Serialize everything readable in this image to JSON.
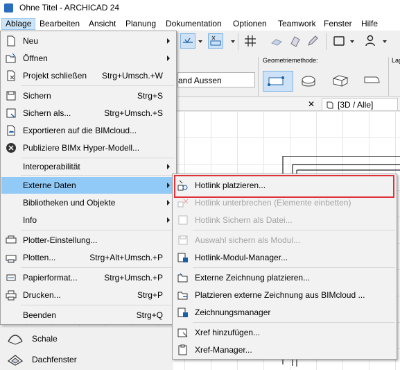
{
  "window": {
    "title": "Ohne Titel - ARCHICAD 24"
  },
  "menubar": {
    "items": [
      "Ablage",
      "Bearbeiten",
      "Ansicht",
      "Planung",
      "Dokumentation",
      "Optionen",
      "Teamwork",
      "Fenster",
      "Hilfe"
    ],
    "active": "Ablage"
  },
  "toolbar": {
    "geometry_label": "Geometriemethode:",
    "layer_combo_text": "and Aussen",
    "right_edge_label": "Lag"
  },
  "tabs": {
    "view_tab": "[3D / Alle]"
  },
  "toolbox": {
    "items": [
      "Schale",
      "Dachfenster"
    ]
  },
  "ablage_menu": {
    "items": [
      {
        "label": "Neu",
        "shortcut": "",
        "submenu": true,
        "icon": "new-document-icon"
      },
      {
        "label": "Öffnen",
        "shortcut": "",
        "submenu": true,
        "icon": "open-folder-icon"
      },
      {
        "label": "Projekt schließen",
        "shortcut": "Strg+Umsch.+W",
        "submenu": false,
        "icon": "close-project-icon"
      },
      {
        "label": "Sichern",
        "shortcut": "Strg+S",
        "submenu": false,
        "icon": "save-icon"
      },
      {
        "label": "Sichern als...",
        "shortcut": "Strg+Umsch.+S",
        "submenu": false,
        "icon": "save-as-icon"
      },
      {
        "label": "Exportieren auf die BIMcloud...",
        "shortcut": "",
        "submenu": false,
        "icon": "bimcloud-export-icon"
      },
      {
        "label": "Publiziere BIMx Hyper-Modell...",
        "shortcut": "",
        "submenu": false,
        "icon": "bimx-icon"
      },
      {
        "label": "Interoperabilität",
        "shortcut": "",
        "submenu": true,
        "icon": ""
      },
      {
        "label": "Externe Daten",
        "shortcut": "",
        "submenu": true,
        "icon": ""
      },
      {
        "label": "Bibliotheken und Objekte",
        "shortcut": "",
        "submenu": true,
        "icon": ""
      },
      {
        "label": "Info",
        "shortcut": "",
        "submenu": true,
        "icon": ""
      },
      {
        "label": "Plotter-Einstellung...",
        "shortcut": "",
        "submenu": false,
        "icon": "plotter-setup-icon"
      },
      {
        "label": "Plotten...",
        "shortcut": "Strg+Alt+Umsch.+P",
        "submenu": false,
        "icon": "plot-icon"
      },
      {
        "label": "Papierformat...",
        "shortcut": "Strg+Umsch.+P",
        "submenu": false,
        "icon": "page-setup-icon"
      },
      {
        "label": "Drucken...",
        "shortcut": "Strg+P",
        "submenu": false,
        "icon": "print-icon"
      },
      {
        "label": "Beenden",
        "shortcut": "Strg+Q",
        "submenu": false,
        "icon": ""
      }
    ]
  },
  "extern_submenu": {
    "items": [
      {
        "label": "Hotlink platzieren...",
        "disabled": false,
        "icon": "hotlink-place-icon"
      },
      {
        "label": "Hotlink unterbrechen (Elemente einbetten)",
        "disabled": true,
        "icon": "hotlink-break-icon"
      },
      {
        "label": "Hotlink Sichern als Datei...",
        "disabled": true,
        "icon": "hotlink-save-icon"
      },
      {
        "label": "Auswahl sichern als Modul...",
        "disabled": true,
        "icon": "save-module-icon"
      },
      {
        "label": "Hotlink-Modul-Manager...",
        "disabled": false,
        "icon": "hotlink-manager-icon"
      },
      {
        "label": "Externe Zeichnung platzieren...",
        "disabled": false,
        "icon": "external-drawing-icon"
      },
      {
        "label": "Platzieren externe Zeichnung aus BIMcloud ...",
        "disabled": false,
        "icon": "bimcloud-drawing-icon"
      },
      {
        "label": "Zeichnungsmanager",
        "disabled": false,
        "icon": "drawing-manager-icon"
      },
      {
        "label": "Xref hinzufügen...",
        "disabled": false,
        "icon": "xref-add-icon"
      },
      {
        "label": "Xref-Manager...",
        "disabled": false,
        "icon": "xref-manager-icon"
      }
    ]
  },
  "colors": {
    "highlight": "#91c9f7",
    "annotation": "#e0303a",
    "menu_bg": "#f2f2f2"
  }
}
